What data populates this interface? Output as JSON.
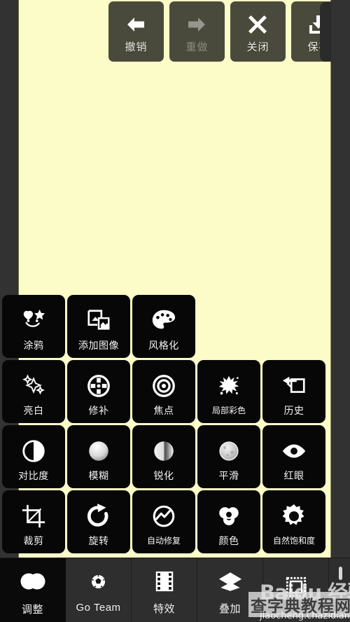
{
  "app": {
    "canvas_color": "#fcfcc8",
    "background_color": "#323232"
  },
  "toolbar": {
    "buttons": [
      {
        "label": "撤销",
        "icon": "arrow-left-icon",
        "enabled": true
      },
      {
        "label": "重做",
        "icon": "arrow-right-icon",
        "enabled": false
      },
      {
        "label": "关闭",
        "icon": "close-x-icon",
        "enabled": true
      },
      {
        "label": "保存",
        "icon": "save-download-icon",
        "enabled": true
      }
    ]
  },
  "tool_grid": {
    "rows": [
      [
        {
          "label": "涂鸦",
          "icon": "doodle-icon"
        },
        {
          "label": "添加图像",
          "icon": "add-image-icon"
        },
        {
          "label": "风格化",
          "icon": "palette-icon"
        }
      ],
      [
        {
          "label": "亮白",
          "icon": "sparkle-icon"
        },
        {
          "label": "修补",
          "icon": "patch-target-icon"
        },
        {
          "label": "焦点",
          "icon": "focus-rings-icon"
        },
        {
          "label": "局部彩色",
          "icon": "splatter-icon"
        },
        {
          "label": "历史",
          "icon": "history-icon"
        }
      ],
      [
        {
          "label": "对比度",
          "icon": "contrast-icon"
        },
        {
          "label": "模糊",
          "icon": "blur-icon"
        },
        {
          "label": "锐化",
          "icon": "sharpen-icon"
        },
        {
          "label": "平滑",
          "icon": "smooth-icon"
        },
        {
          "label": "红眼",
          "icon": "eye-icon"
        }
      ],
      [
        {
          "label": "裁剪",
          "icon": "crop-icon"
        },
        {
          "label": "旋转",
          "icon": "rotate-icon"
        },
        {
          "label": "自动修复",
          "icon": "auto-fix-icon"
        },
        {
          "label": "颜色",
          "icon": "color-circles-icon"
        },
        {
          "label": "自然饱和度",
          "icon": "sun-vibrance-icon"
        }
      ]
    ]
  },
  "bottom_bar": {
    "items": [
      {
        "label": "调整",
        "icon": "adjust-circles-icon",
        "selected": true
      },
      {
        "label": "Go Team",
        "icon": "ball-icon",
        "selected": false
      },
      {
        "label": "特效",
        "icon": "film-strip-icon",
        "selected": false
      },
      {
        "label": "叠加",
        "icon": "layers-icon",
        "selected": false
      },
      {
        "label": "",
        "icon": "frame-border-icon",
        "selected": false
      }
    ]
  },
  "watermark": {
    "baidu": "Baidu 经验",
    "site": "查字典教程网",
    "url": "jiaocheng.chazidian.com"
  }
}
